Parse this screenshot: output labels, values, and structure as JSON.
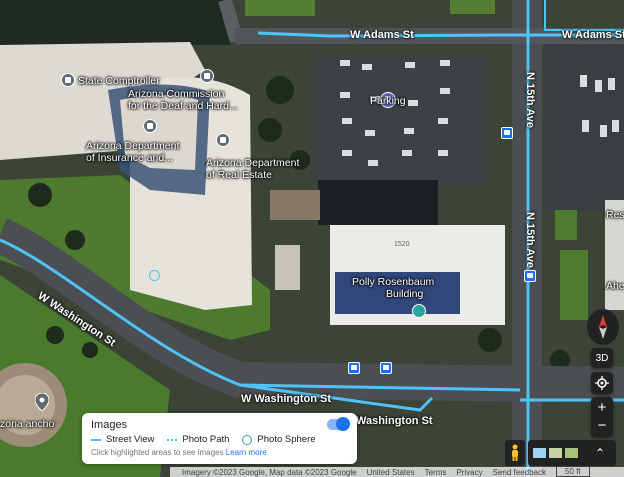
{
  "labels": {
    "state_comptroller": "State Comptroller",
    "az_commission_l1": "Arizona Commission",
    "az_commission_l2": "for the Deaf and Hard...",
    "az_insurance_l1": "Arizona Department",
    "az_insurance_l2": "of Insurance and...",
    "az_real_estate_l1": "Arizona Department",
    "az_real_estate_l2": "of Real Estate",
    "parking": "Parking",
    "polly_l1": "Polly Rosenbaum",
    "polly_l2": "Building",
    "roof_number": "1520",
    "zona_ancho": "zona ancho",
    "resi": "Resi",
    "ahe": "Ahe"
  },
  "streets": {
    "w_adams_1": "W Adams St",
    "w_adams_2": "W Adams St",
    "n_15th_1": "N 15th Ave",
    "n_15th_2": "N 15th Ave",
    "w_washington_diag": "W Washington St",
    "w_washington_2": "W Washington St",
    "w_washington_3": "Washington St"
  },
  "panel": {
    "title": "Images",
    "legend_street_view": "Street View",
    "legend_photo_path": "Photo Path",
    "legend_photo_sphere": "Photo Sphere",
    "hint": "Click highlighted areas to see images",
    "learn_more": "Learn more",
    "toggle_on": true
  },
  "controls": {
    "tilt_label": "3D",
    "zoom_in": "+",
    "zoom_out": "−"
  },
  "footer": {
    "imagery": "Imagery ©2023 Google, Map data ©2023 Google",
    "country": "United States",
    "terms": "Terms",
    "privacy": "Privacy",
    "feedback": "Send feedback",
    "scale": "50 ft"
  },
  "colors": {
    "street_view_line": "#4fc3f7",
    "accent": "#1a73e8",
    "poi_pin": "#5f6b73",
    "parking_pin": "#5c6bc0",
    "building_pin": "#26a69a"
  }
}
